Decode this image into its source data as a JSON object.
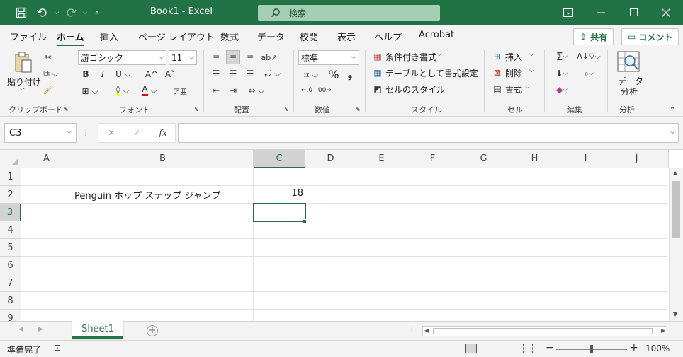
{
  "window": {
    "title": "Book1  -  Excel",
    "search_placeholder": "検索"
  },
  "ribbon_tabs": [
    "ファイル",
    "ホーム",
    "挿入",
    "ページ レイアウト",
    "数式",
    "データ",
    "校閲",
    "表示",
    "ヘルプ",
    "Acrobat"
  ],
  "share_label": "共有",
  "comment_label": "コメント",
  "ribbon": {
    "clipboard": {
      "paste": "貼り付け",
      "label": "クリップボード"
    },
    "font": {
      "name": "游ゴシック",
      "size": "11",
      "label": "フォント"
    },
    "alignment": {
      "label": "配置"
    },
    "number": {
      "format": "標準",
      "label": "数値"
    },
    "styles": {
      "conditional": "条件付き書式",
      "table": "テーブルとして書式設定",
      "cell_style": "セルのスタイル",
      "label": "スタイル"
    },
    "cells": {
      "insert": "挿入",
      "delete": "削除",
      "format": "書式",
      "label": "セル"
    },
    "editing": {
      "label": "編集"
    },
    "analysis": {
      "data_analysis": "データ分析",
      "data_analysis_line1": "データ",
      "data_analysis_line2": "分析",
      "label": "分析"
    }
  },
  "formula_bar": {
    "name_box": "C3",
    "fx": "fx",
    "content": ""
  },
  "columns": [
    "A",
    "B",
    "C",
    "D",
    "E",
    "F",
    "G",
    "H",
    "I",
    "J"
  ],
  "rows": [
    "1",
    "2",
    "3",
    "4",
    "5",
    "6",
    "7",
    "8",
    "9"
  ],
  "cells": {
    "B2": "Penguin ホップ ステップ ジャンプ",
    "C2": "18"
  },
  "selected_cell": "C3",
  "sheets": [
    "Sheet1"
  ],
  "status": {
    "ready": "準備完了",
    "zoom": "100%"
  },
  "colors": {
    "accent": "#217346",
    "search_bg": "#a5cfb5"
  }
}
